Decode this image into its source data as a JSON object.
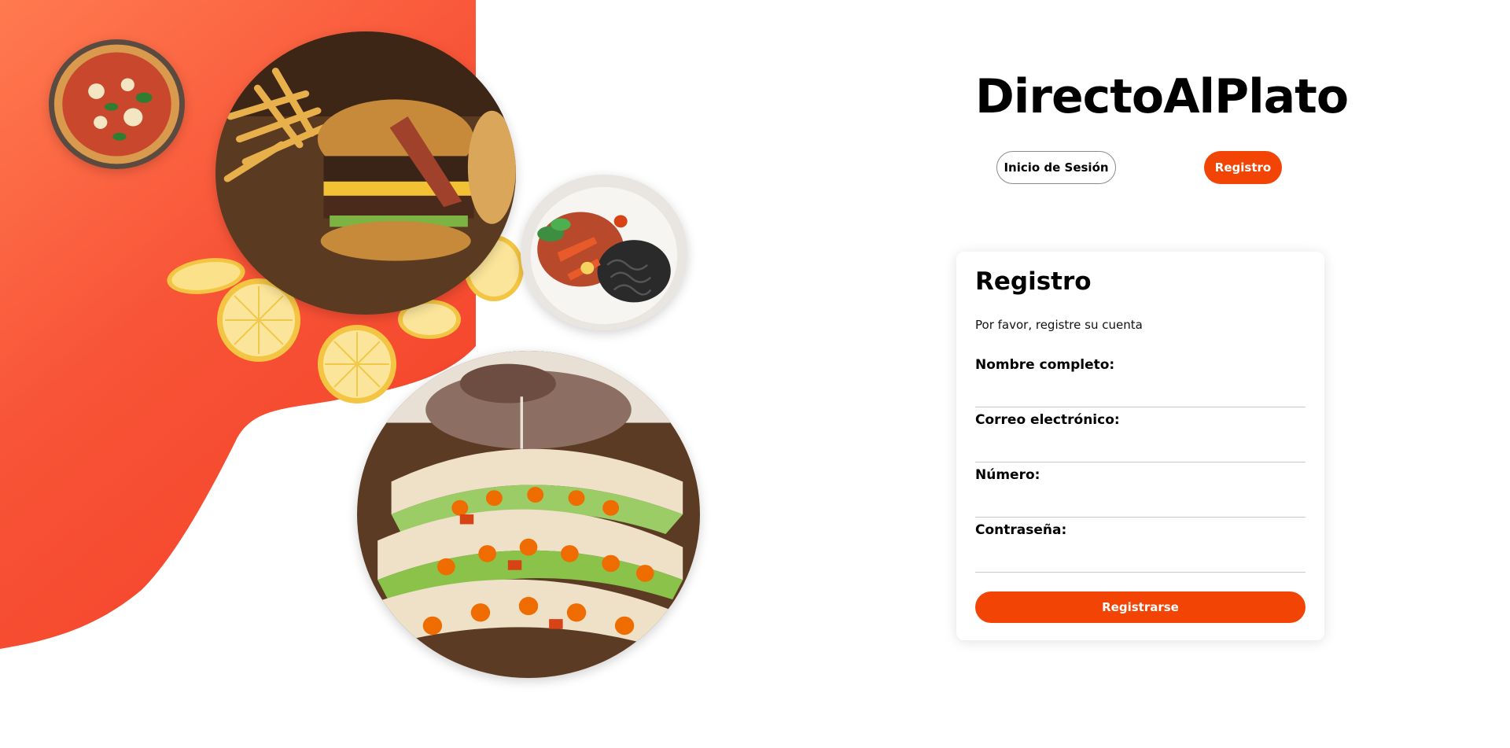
{
  "app": {
    "brand": "DirectoAlPlato"
  },
  "auth_tabs": {
    "login_label": "Inicio de Sesión",
    "register_label": "Registro",
    "active": "register"
  },
  "form": {
    "title": "Registro",
    "subtitle": "Por favor, registre su cuenta",
    "fields": [
      {
        "label": "Nombre completo:",
        "value": ""
      },
      {
        "label": "Correo electrónico:",
        "value": ""
      },
      {
        "label": "Número:",
        "value": ""
      },
      {
        "label": "Contraseña:",
        "value": ""
      }
    ],
    "submit_label": "Registrarse"
  },
  "hero": {
    "images": [
      "pizza-image",
      "burger-fries-image",
      "pasta-vegetables-image",
      "tacos-image"
    ],
    "decorations": [
      "lemon-slice-icon"
    ]
  },
  "colors": {
    "accent": "#f24405",
    "blob_top": "#ff7a50",
    "blob_bottom": "#f4442a",
    "text": "#000000",
    "background": "#ffffff"
  }
}
